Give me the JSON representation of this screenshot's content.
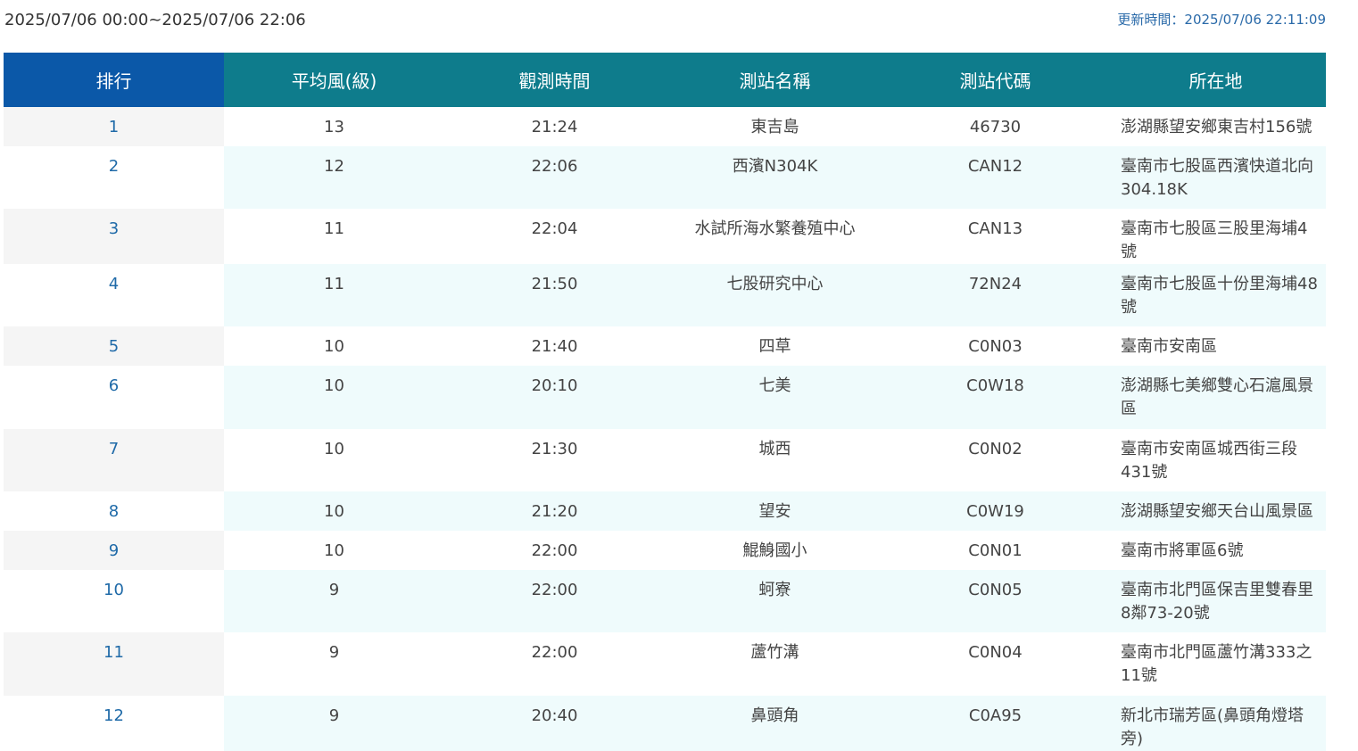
{
  "header": {
    "range": "2025/07/06 00:00~2025/07/06 22:06",
    "update": "更新時間：2025/07/06 22:11:09"
  },
  "table": {
    "columns": [
      "排行",
      "平均風(級)",
      "觀測時間",
      "測站名稱",
      "測站代碼",
      "所在地"
    ],
    "rows": [
      {
        "rank": "1",
        "wind": "13",
        "time": "21:24",
        "name": "東吉島",
        "code": "46730",
        "location": "澎湖縣望安鄉東吉村156號"
      },
      {
        "rank": "2",
        "wind": "12",
        "time": "22:06",
        "name": "西濱N304K",
        "code": "CAN12",
        "location": "臺南市七股區西濱快道北向304.18K"
      },
      {
        "rank": "3",
        "wind": "11",
        "time": "22:04",
        "name": "水試所海水繁養殖中心",
        "code": "CAN13",
        "location": "臺南市七股區三股里海埔4號"
      },
      {
        "rank": "4",
        "wind": "11",
        "time": "21:50",
        "name": "七股研究中心",
        "code": "72N24",
        "location": "臺南市七股區十份里海埔48號"
      },
      {
        "rank": "5",
        "wind": "10",
        "time": "21:40",
        "name": "四草",
        "code": "C0N03",
        "location": "臺南市安南區"
      },
      {
        "rank": "6",
        "wind": "10",
        "time": "20:10",
        "name": "七美",
        "code": "C0W18",
        "location": "澎湖縣七美鄉雙心石滬風景區"
      },
      {
        "rank": "7",
        "wind": "10",
        "time": "21:30",
        "name": "城西",
        "code": "C0N02",
        "location": "臺南市安南區城西街三段431號"
      },
      {
        "rank": "8",
        "wind": "10",
        "time": "21:20",
        "name": "望安",
        "code": "C0W19",
        "location": "澎湖縣望安鄉天台山風景區"
      },
      {
        "rank": "9",
        "wind": "10",
        "time": "22:00",
        "name": "鯤鯓國小",
        "code": "C0N01",
        "location": "臺南市將軍區6號"
      },
      {
        "rank": "10",
        "wind": "9",
        "time": "22:00",
        "name": "蚵寮",
        "code": "C0N05",
        "location": "臺南市北門區保吉里雙春里8鄰73-20號"
      },
      {
        "rank": "11",
        "wind": "9",
        "time": "22:00",
        "name": "蘆竹溝",
        "code": "C0N04",
        "location": "臺南市北門區蘆竹溝333之11號"
      },
      {
        "rank": "12",
        "wind": "9",
        "time": "20:40",
        "name": "鼻頭角",
        "code": "C0A95",
        "location": "新北市瑞芳區(鼻頭角燈塔旁)"
      }
    ]
  }
}
